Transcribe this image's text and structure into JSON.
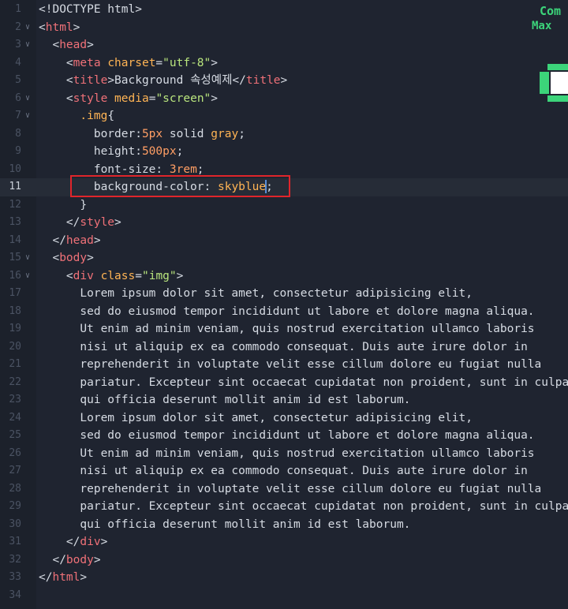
{
  "editor": {
    "active_line": 11,
    "accent_highlight": "#e0252b",
    "lines": [
      {
        "n": "1",
        "fold": "",
        "tokens": [
          {
            "c": "p",
            "t": "<!DOCTYPE html>"
          }
        ]
      },
      {
        "n": "2",
        "fold": "v",
        "tokens": [
          {
            "c": "p",
            "t": "<"
          },
          {
            "c": "t",
            "t": "html"
          },
          {
            "c": "p",
            "t": ">"
          }
        ]
      },
      {
        "n": "3",
        "fold": "v",
        "tokens": [
          {
            "c": "p",
            "t": "  <"
          },
          {
            "c": "t",
            "t": "head"
          },
          {
            "c": "p",
            "t": ">"
          }
        ]
      },
      {
        "n": "4",
        "fold": "",
        "tokens": [
          {
            "c": "p",
            "t": "    <"
          },
          {
            "c": "t",
            "t": "meta"
          },
          {
            "c": "p",
            "t": " "
          },
          {
            "c": "a",
            "t": "charset"
          },
          {
            "c": "p",
            "t": "="
          },
          {
            "c": "s",
            "t": "\"utf-8\""
          },
          {
            "c": "p",
            "t": ">"
          }
        ]
      },
      {
        "n": "5",
        "fold": "",
        "tokens": [
          {
            "c": "p",
            "t": "    <"
          },
          {
            "c": "t",
            "t": "title"
          },
          {
            "c": "p",
            "t": ">Background 속성예제</"
          },
          {
            "c": "t",
            "t": "title"
          },
          {
            "c": "p",
            "t": ">"
          }
        ]
      },
      {
        "n": "6",
        "fold": "v",
        "tokens": [
          {
            "c": "p",
            "t": "    <"
          },
          {
            "c": "t",
            "t": "style"
          },
          {
            "c": "p",
            "t": " "
          },
          {
            "c": "a",
            "t": "media"
          },
          {
            "c": "p",
            "t": "="
          },
          {
            "c": "s",
            "t": "\"screen\""
          },
          {
            "c": "p",
            "t": ">"
          }
        ]
      },
      {
        "n": "7",
        "fold": "v",
        "tokens": [
          {
            "c": "a",
            "t": "      .img"
          },
          {
            "c": "p",
            "t": "{"
          }
        ]
      },
      {
        "n": "8",
        "fold": "",
        "tokens": [
          {
            "c": "pr",
            "t": "        border:"
          },
          {
            "c": "v",
            "t": "5px"
          },
          {
            "c": "p",
            "t": " solid "
          },
          {
            "c": "a",
            "t": "gray"
          },
          {
            "c": "p",
            "t": ";"
          }
        ]
      },
      {
        "n": "9",
        "fold": "",
        "tokens": [
          {
            "c": "pr",
            "t": "        height:"
          },
          {
            "c": "v",
            "t": "500px"
          },
          {
            "c": "p",
            "t": ";"
          }
        ]
      },
      {
        "n": "10",
        "fold": "",
        "tokens": [
          {
            "c": "pr",
            "t": "        font-size: "
          },
          {
            "c": "v",
            "t": "3rem"
          },
          {
            "c": "p",
            "t": ";"
          }
        ]
      },
      {
        "n": "11",
        "fold": "",
        "tokens": [
          {
            "c": "pr",
            "t": "        background-color: "
          },
          {
            "c": "a",
            "t": "skyblue"
          },
          {
            "c": "p",
            "t": ";"
          }
        ]
      },
      {
        "n": "12",
        "fold": "",
        "tokens": [
          {
            "c": "p",
            "t": "      }"
          }
        ]
      },
      {
        "n": "13",
        "fold": "",
        "tokens": [
          {
            "c": "p",
            "t": "    </"
          },
          {
            "c": "t",
            "t": "style"
          },
          {
            "c": "p",
            "t": ">"
          }
        ]
      },
      {
        "n": "14",
        "fold": "",
        "tokens": [
          {
            "c": "p",
            "t": "  </"
          },
          {
            "c": "t",
            "t": "head"
          },
          {
            "c": "p",
            "t": ">"
          }
        ]
      },
      {
        "n": "15",
        "fold": "v",
        "tokens": [
          {
            "c": "p",
            "t": "  <"
          },
          {
            "c": "t",
            "t": "body"
          },
          {
            "c": "p",
            "t": ">"
          }
        ]
      },
      {
        "n": "16",
        "fold": "v",
        "tokens": [
          {
            "c": "p",
            "t": "    <"
          },
          {
            "c": "t",
            "t": "div"
          },
          {
            "c": "p",
            "t": " "
          },
          {
            "c": "a",
            "t": "class"
          },
          {
            "c": "p",
            "t": "="
          },
          {
            "c": "s",
            "t": "\"img\""
          },
          {
            "c": "p",
            "t": ">"
          }
        ]
      },
      {
        "n": "17",
        "fold": "",
        "tokens": [
          {
            "c": "p",
            "t": "      Lorem ipsum dolor sit amet, consectetur adipisicing elit,"
          }
        ]
      },
      {
        "n": "18",
        "fold": "",
        "tokens": [
          {
            "c": "p",
            "t": "      sed do eiusmod tempor incididunt ut labore et dolore magna aliqua."
          }
        ]
      },
      {
        "n": "19",
        "fold": "",
        "tokens": [
          {
            "c": "p",
            "t": "      Ut enim ad minim veniam, quis nostrud exercitation ullamco laboris"
          }
        ]
      },
      {
        "n": "20",
        "fold": "",
        "tokens": [
          {
            "c": "p",
            "t": "      nisi ut aliquip ex ea commodo consequat. Duis aute irure dolor in"
          }
        ]
      },
      {
        "n": "21",
        "fold": "",
        "tokens": [
          {
            "c": "p",
            "t": "      reprehenderit in voluptate velit esse cillum dolore eu fugiat nulla"
          }
        ]
      },
      {
        "n": "22",
        "fold": "",
        "tokens": [
          {
            "c": "p",
            "t": "      pariatur. Excepteur sint occaecat cupidatat non proident, sunt in culpa"
          }
        ]
      },
      {
        "n": "23",
        "fold": "",
        "tokens": [
          {
            "c": "p",
            "t": "      qui officia deserunt mollit anim id est laborum."
          }
        ]
      },
      {
        "n": "24",
        "fold": "",
        "tokens": [
          {
            "c": "p",
            "t": "      Lorem ipsum dolor sit amet, consectetur adipisicing elit,"
          }
        ]
      },
      {
        "n": "25",
        "fold": "",
        "tokens": [
          {
            "c": "p",
            "t": "      sed do eiusmod tempor incididunt ut labore et dolore magna aliqua."
          }
        ]
      },
      {
        "n": "26",
        "fold": "",
        "tokens": [
          {
            "c": "p",
            "t": "      Ut enim ad minim veniam, quis nostrud exercitation ullamco laboris"
          }
        ]
      },
      {
        "n": "27",
        "fold": "",
        "tokens": [
          {
            "c": "p",
            "t": "      nisi ut aliquip ex ea commodo consequat. Duis aute irure dolor in"
          }
        ]
      },
      {
        "n": "28",
        "fold": "",
        "tokens": [
          {
            "c": "p",
            "t": "      reprehenderit in voluptate velit esse cillum dolore eu fugiat nulla"
          }
        ]
      },
      {
        "n": "29",
        "fold": "",
        "tokens": [
          {
            "c": "p",
            "t": "      pariatur. Excepteur sint occaecat cupidatat non proident, sunt in culpa"
          }
        ]
      },
      {
        "n": "30",
        "fold": "",
        "tokens": [
          {
            "c": "p",
            "t": "      qui officia deserunt mollit anim id est laborum."
          }
        ]
      },
      {
        "n": "31",
        "fold": "",
        "tokens": [
          {
            "c": "p",
            "t": "    </"
          },
          {
            "c": "t",
            "t": "div"
          },
          {
            "c": "p",
            "t": ">"
          }
        ]
      },
      {
        "n": "32",
        "fold": "",
        "tokens": [
          {
            "c": "p",
            "t": "  </"
          },
          {
            "c": "t",
            "t": "body"
          },
          {
            "c": "p",
            "t": ">"
          }
        ]
      },
      {
        "n": "33",
        "fold": "",
        "tokens": [
          {
            "c": "p",
            "t": "</"
          },
          {
            "c": "t",
            "t": "html"
          },
          {
            "c": "p",
            "t": ">"
          }
        ]
      },
      {
        "n": "34",
        "fold": "",
        "tokens": []
      }
    ]
  },
  "minimap": {
    "label_top": "Com",
    "label_bottom": "Max"
  }
}
